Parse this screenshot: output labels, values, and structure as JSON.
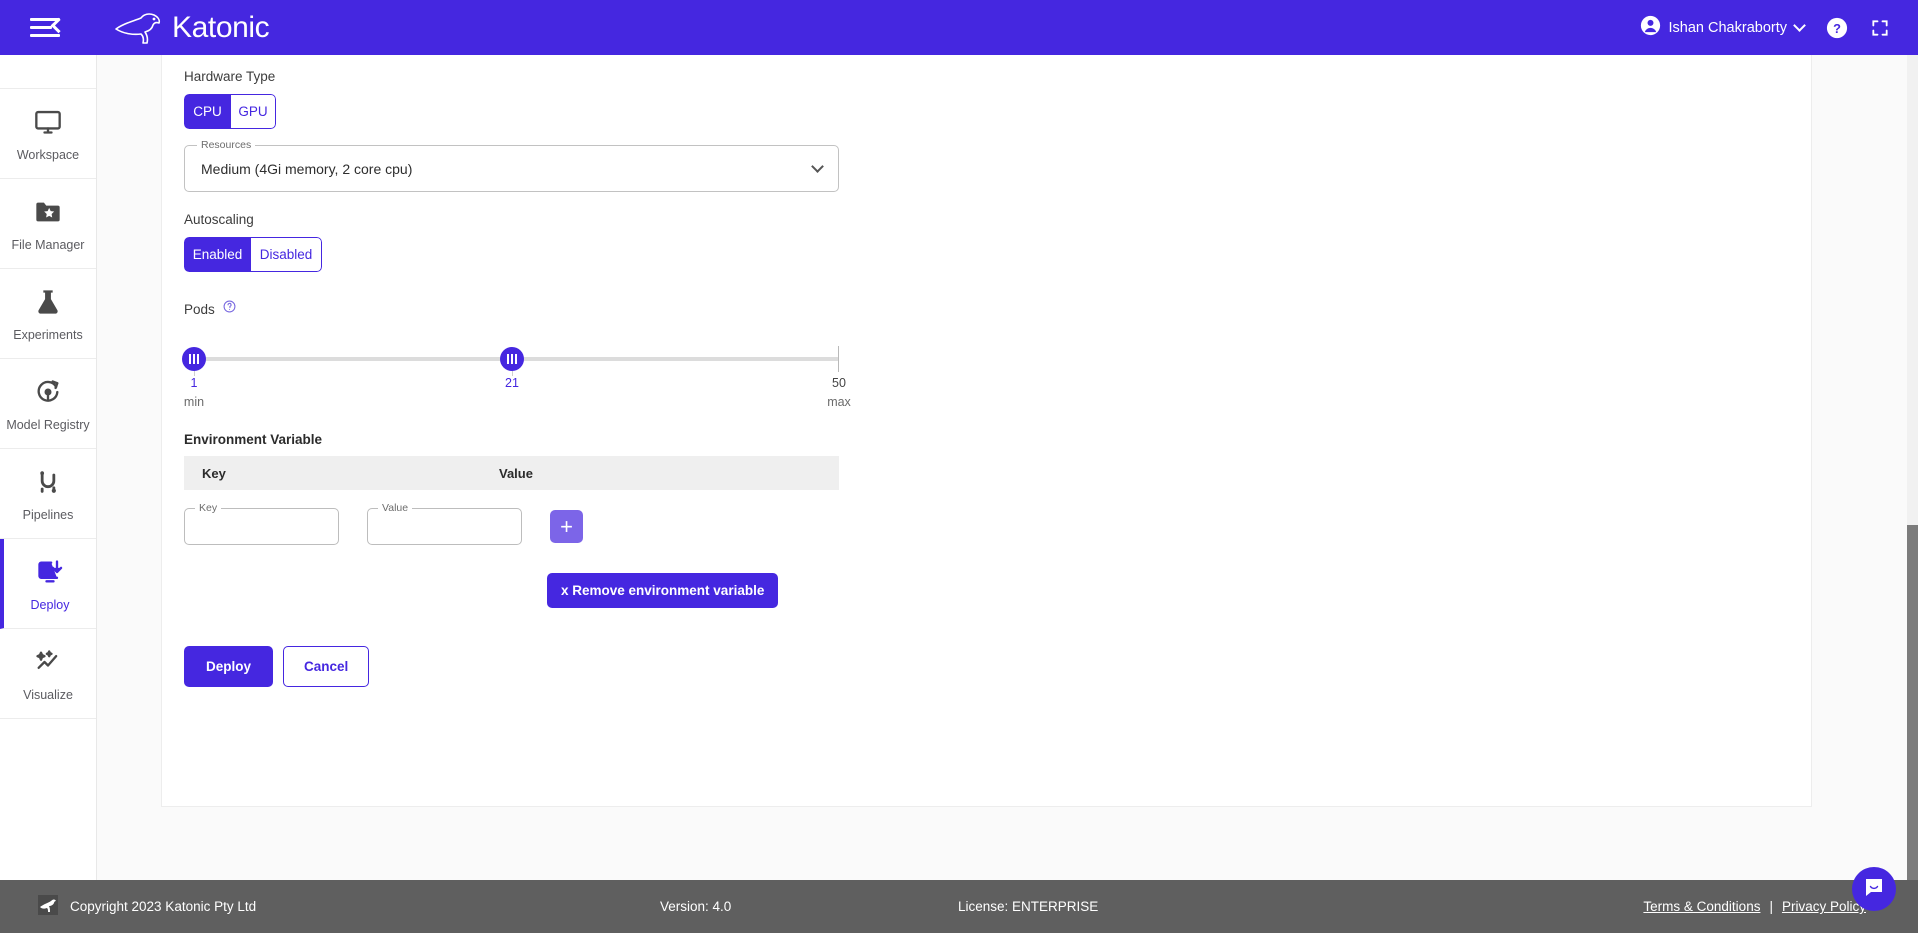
{
  "header": {
    "menu_icon": "hamburger-menu-icon",
    "brand": "Katonic",
    "user_name": "Ishan Chakraborty",
    "help_icon": "help-circle-icon",
    "fullscreen_icon": "fullscreen-icon",
    "avatar_icon": "user-avatar-icon",
    "chevron_icon": "chevron-down-icon"
  },
  "sidebar": {
    "items": [
      {
        "label": "Workspace",
        "icon": "monitor-icon",
        "active": false
      },
      {
        "label": "File Manager",
        "icon": "folder-star-icon",
        "active": false
      },
      {
        "label": "Experiments",
        "icon": "flask-icon",
        "active": false
      },
      {
        "label": "Model Registry",
        "icon": "model-refresh-icon",
        "active": false
      },
      {
        "label": "Pipelines",
        "icon": "pipeline-icon",
        "active": false
      },
      {
        "label": "Deploy",
        "icon": "deploy-download-icon",
        "active": true
      },
      {
        "label": "Visualize",
        "icon": "sparkle-chart-icon",
        "active": false
      }
    ]
  },
  "form": {
    "hardware_type": {
      "label": "Hardware Type",
      "options": [
        "CPU",
        "GPU"
      ],
      "selected": "CPU"
    },
    "resources": {
      "legend": "Resources",
      "value": "Medium (4Gi memory, 2 core cpu)"
    },
    "autoscaling": {
      "label": "Autoscaling",
      "options": [
        "Enabled",
        "Disabled"
      ],
      "selected": "Enabled"
    },
    "pods": {
      "label": "Pods",
      "help_icon": "help-circle-icon",
      "min_value": "1",
      "mid_value": "21",
      "max_value": "50",
      "min_caption": "min",
      "max_caption": "max",
      "range_min": 1,
      "range_max": 50
    },
    "environment_variable": {
      "title": "Environment Variable",
      "columns": [
        "Key",
        "Value"
      ],
      "key_legend": "Key",
      "key_value": "",
      "key_placeholder": "",
      "value_legend": "Value",
      "value_value": "",
      "value_placeholder": "",
      "add_label": "+",
      "remove_label": "x Remove environment variable"
    },
    "actions": {
      "deploy": "Deploy",
      "cancel": "Cancel"
    }
  },
  "footer": {
    "copyright": "Copyright 2023 Katonic Pty Ltd",
    "version": "Version: 4.0",
    "license": "License: ENTERPRISE",
    "terms": "Terms & Conditions",
    "separator": "|",
    "privacy": "Privacy Policy",
    "logo_icon": "katonic-mark-icon"
  },
  "chat": {
    "icon": "chat-bubble-icon"
  },
  "colors": {
    "brand_purple": "#4527e0",
    "light_purple": "#7c65e8",
    "footer_grey": "#5f5f5f",
    "page_bg": "#fafafa"
  }
}
